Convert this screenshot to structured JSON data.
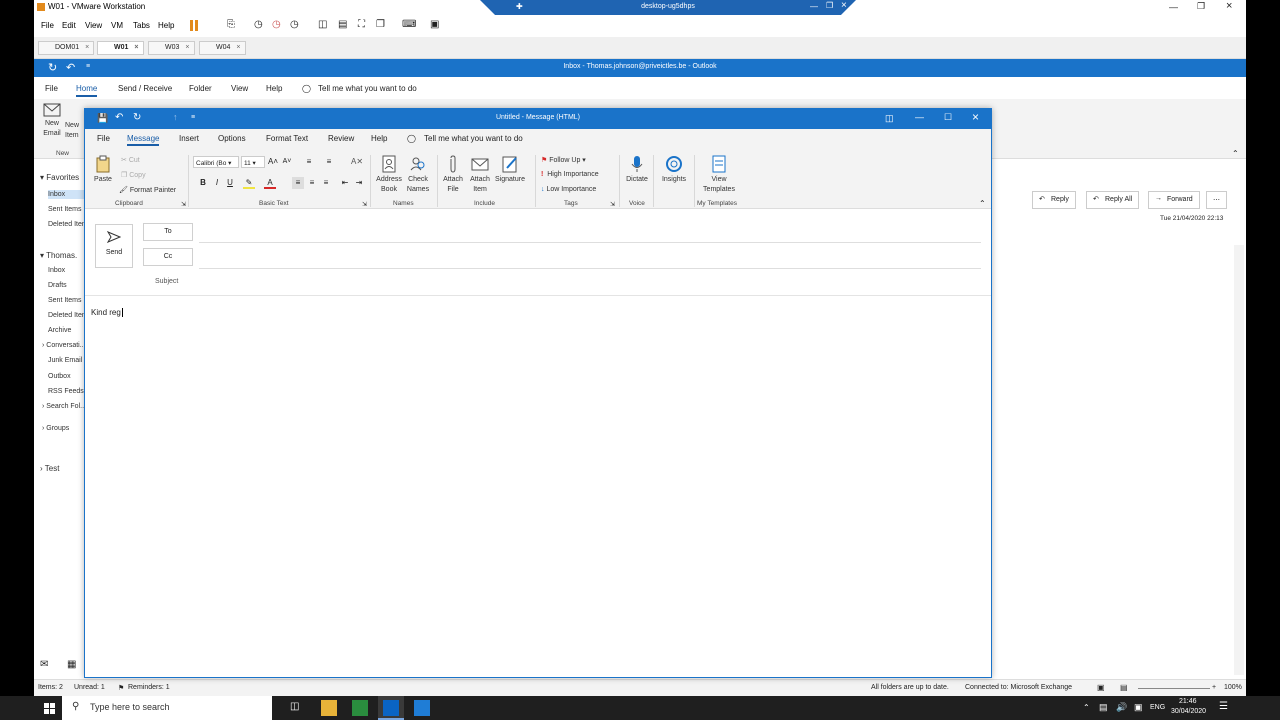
{
  "vmware": {
    "title": "W01 - VMware Workstation",
    "menu": [
      "File",
      "Edit",
      "View",
      "VM",
      "Tabs",
      "Help"
    ],
    "tabs": [
      "DOM01",
      "W01",
      "W03",
      "W04"
    ],
    "banner_host": "desktop-ug5dhps"
  },
  "outlook": {
    "title": "Inbox - Thomas.johnson@priveictles.be  -  Outlook",
    "menu": [
      "File",
      "Home",
      "Send / Receive",
      "Folder",
      "View",
      "Help"
    ],
    "tell_me": "Tell me what you want to do",
    "ribbon": {
      "new_email": "New\nEmail",
      "new_items": "New\nItems",
      "new_group": "New"
    },
    "nav": {
      "favorites": "Favorites",
      "fav_items": [
        "Inbox",
        "Sent Items",
        "Deleted Items"
      ],
      "account": "Thomas.",
      "account_items": [
        "Inbox",
        "Drafts",
        "Sent Items",
        "Deleted Items",
        "Archive"
      ],
      "conversation": "Conversati...",
      "more_items": [
        "Junk Email",
        "Outbox",
        "RSS Feeds"
      ],
      "search_folders": "Search Fol...",
      "groups": "Groups",
      "test": "Test"
    },
    "reading": {
      "reply": "Reply",
      "reply_all": "Reply All",
      "forward": "Forward",
      "date": "Tue 21/04/2020 22:13"
    },
    "status": {
      "items": "Items: 2",
      "unread": "Unread: 1",
      "reminders": "Reminders: 1",
      "sync": "All folders are up to date.",
      "connection": "Connected to: Microsoft Exchange",
      "zoom": "100%"
    }
  },
  "compose": {
    "title": "Untitled  -  Message (HTML)",
    "menu": [
      "File",
      "Message",
      "Insert",
      "Options",
      "Format Text",
      "Review",
      "Help"
    ],
    "tell_me": "Tell me what you want to do",
    "clipboard": {
      "paste": "Paste",
      "cut": "Cut",
      "copy": "Copy",
      "format_painter": "Format Painter",
      "group": "Clipboard"
    },
    "basic_text": {
      "font": "Calibri (Bo",
      "size": "11",
      "group": "Basic Text"
    },
    "names": {
      "address_book": "Address\nBook",
      "check_names": "Check\nNames",
      "group": "Names"
    },
    "include": {
      "attach_file": "Attach\nFile",
      "attach_item": "Attach\nItem",
      "signature": "Signature",
      "group": "Include"
    },
    "tags": {
      "follow_up": "Follow Up",
      "high": "High Importance",
      "low": "Low Importance",
      "group": "Tags"
    },
    "voice": {
      "dictate": "Dictate",
      "group": "Voice"
    },
    "insights": "Insights",
    "templates": {
      "view": "View\nTemplates",
      "group": "My Templates"
    },
    "send": "Send",
    "to": "To",
    "cc": "Cc",
    "subject": "Subject",
    "body": "Kind reg"
  },
  "taskbar": {
    "search_placeholder": "Type here to search",
    "lang": "ENG",
    "time": "21:46",
    "date": "30/04/2020"
  },
  "colors": {
    "outlook_blue": "#1a73c9",
    "vm_banner": "#1f64b2"
  }
}
